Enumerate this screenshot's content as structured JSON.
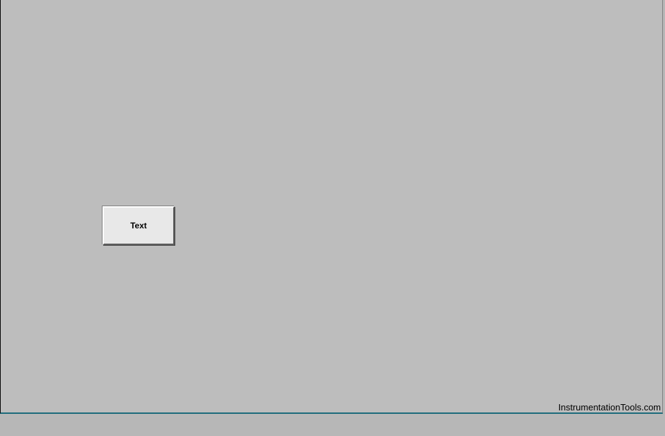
{
  "canvas": {
    "button": {
      "label": "Text"
    }
  },
  "footer": {
    "watermark": "InstrumentationTools.com"
  }
}
